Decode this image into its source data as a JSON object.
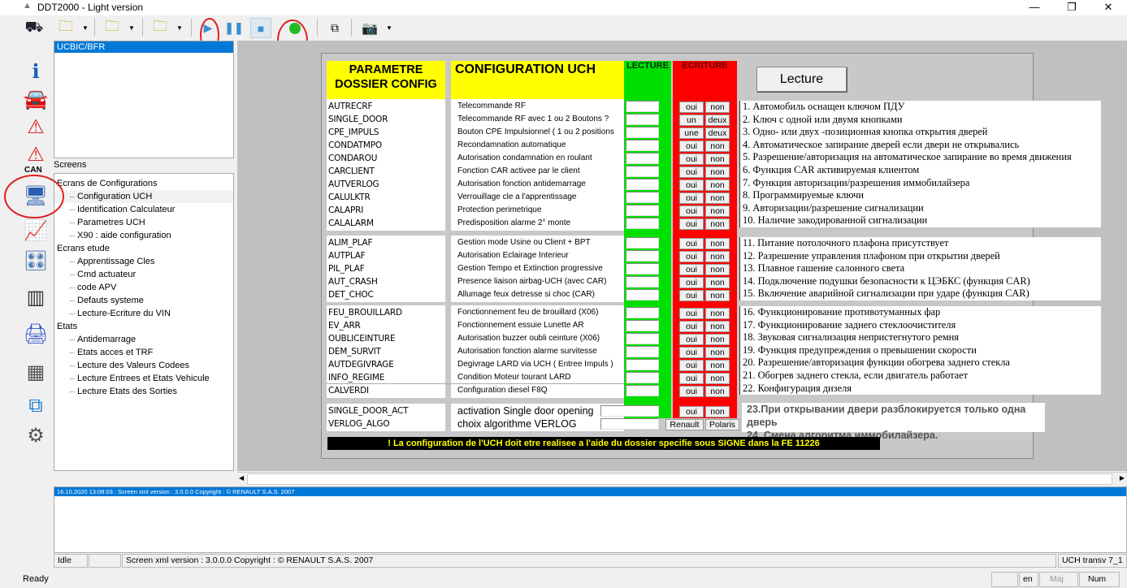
{
  "window": {
    "title": "DDT2000 - Light version",
    "controls": [
      "minimize",
      "restore",
      "close"
    ]
  },
  "toolbar": {
    "icons": [
      "binoculars-can-icon",
      "vehicle-folder-icon",
      "user-folder-icon",
      "window-folder-icon",
      "play-icon",
      "pause-icon",
      "stop-icon",
      "record-green-icon",
      "popout-window-icon",
      "camera-icon"
    ]
  },
  "left_icons": [
    "info-icon",
    "vehicle-icon",
    "warning-icon",
    "can-warning-icon",
    "monitor-icon",
    "chart-save-icon",
    "control-panel-icon",
    "barcode-icon",
    "ecu-program-icon",
    "chip-icon",
    "external-window-icon",
    "gear-icon"
  ],
  "can_label": "CAN",
  "ecu_list": {
    "selected": "UCBIC/BFR"
  },
  "screens_label": "Screens",
  "tree": [
    {
      "level": 1,
      "label": "Ecrans de Configurations"
    },
    {
      "level": 2,
      "label": "Configuration UCH"
    },
    {
      "level": 2,
      "label": "Identification Calculateur"
    },
    {
      "level": 2,
      "label": "Parametres UCH"
    },
    {
      "level": 2,
      "label": "X90 : aide configuration"
    },
    {
      "level": 1,
      "label": "Ecrans etude"
    },
    {
      "level": 2,
      "label": "Apprentissage Cles"
    },
    {
      "level": 2,
      "label": "Cmd actuateur"
    },
    {
      "level": 2,
      "label": "code APV"
    },
    {
      "level": 2,
      "label": "Defauts systeme"
    },
    {
      "level": 2,
      "label": "Lecture-Ecriture du VIN"
    },
    {
      "level": 1,
      "label": "Etats"
    },
    {
      "level": 2,
      "label": "Antidemarrage"
    },
    {
      "level": 2,
      "label": "Etats acces et TRF"
    },
    {
      "level": 2,
      "label": "Lecture des Valeurs Codees"
    },
    {
      "level": 2,
      "label": "Lecture Entrees et Etats Vehicule"
    },
    {
      "level": 2,
      "label": "Lecture Etats des Sorties"
    }
  ],
  "config": {
    "header_param": "PARAMETRE DOSSIER CONFIG",
    "header_config": "CONFIGURATION UCH",
    "header_lecture": "LECTURE",
    "header_ecriture": "ECRITURE",
    "lecture_button": "Lecture",
    "colors": {
      "yellow": "#ffff00",
      "green": "#00e000",
      "red": "#ff0000"
    },
    "groups": [
      [
        {
          "param": "AUTRECRF",
          "desc": "Telecommande RF",
          "value": "",
          "b1": "oui",
          "b2": "non"
        },
        {
          "param": "SINGLE_DOOR",
          "desc": "Telecommande RF avec 1 ou 2 Boutons ?",
          "value": "",
          "b1": "un",
          "b2": "deux"
        },
        {
          "param": "CPE_IMPULS",
          "desc": "Bouton CPE Impulsionnel ( 1 ou 2 positions",
          "value": "",
          "b1": "une",
          "b2": "deux"
        },
        {
          "param": "CONDATMPO",
          "desc": "Recondamnation automatique",
          "value": "",
          "b1": "oui",
          "b2": "non"
        },
        {
          "param": "CONDAROU",
          "desc": "Autorisation condamnation en roulant",
          "value": "",
          "b1": "oui",
          "b2": "non"
        },
        {
          "param": "CARCLIENT",
          "desc": "Fonction CAR activee par le client",
          "value": "",
          "b1": "oui",
          "b2": "non"
        },
        {
          "param": "AUTVERLOG",
          "desc": "Autorisation  fonction antidemarrage",
          "value": "",
          "b1": "oui",
          "b2": "non"
        },
        {
          "param": "CALULKTR",
          "desc": "Verrouillage cle a l'apprentissage",
          "value": "",
          "b1": "oui",
          "b2": "non"
        },
        {
          "param": "CALAPRI",
          "desc": "Protection perimetrique",
          "value": "",
          "b1": "oui",
          "b2": "non"
        },
        {
          "param": "CALALARM",
          "desc": "Predisposition alarme 2° monte",
          "value": "",
          "b1": "oui",
          "b2": "non"
        }
      ],
      [
        {
          "param": "ALIM_PLAF",
          "desc": "Gestion mode Usine ou Client + BPT",
          "value": "",
          "b1": "oui",
          "b2": "non"
        },
        {
          "param": "AUTPLAF",
          "desc": "Autorisation Eclairage Interieur",
          "value": "",
          "b1": "oui",
          "b2": "non"
        },
        {
          "param": "PIL_PLAF",
          "desc": "Gestion Tempo et Extinction progressive",
          "value": "",
          "b1": "oui",
          "b2": "non"
        },
        {
          "param": "AUT_CRASH",
          "desc": "Presence liaison airbag-UCH (avec CAR)",
          "value": "",
          "b1": "oui",
          "b2": "non"
        },
        {
          "param": "DET_CHOC",
          "desc": "Allumage feux detresse si choc (CAR)",
          "value": "",
          "b1": "oui",
          "b2": "non"
        }
      ],
      [
        {
          "param": "FEU_BROUILLARD",
          "desc": "Fonctionnement feu de brouillard (X06)",
          "value": "",
          "b1": "oui",
          "b2": "non"
        },
        {
          "param": "EV_ARR",
          "desc": "Fonctionnement essuie Lunette AR",
          "value": "",
          "b1": "oui",
          "b2": "non"
        },
        {
          "param": "OUBLICEINTURE",
          "desc": "Autorisation buzzer oubli ceinture (X06)",
          "value": "",
          "b1": "oui",
          "b2": "non"
        },
        {
          "param": "DEM_SURVIT",
          "desc": "Autorisation fonction alarme survitesse",
          "value": "",
          "b1": "oui",
          "b2": "non"
        },
        {
          "param": "AUTDEGIVRAGE",
          "desc": "Degivrage LARD via UCH ( Entree Impuls )",
          "value": "",
          "b1": "oui",
          "b2": "non"
        },
        {
          "param": "INFO_REGIME",
          "desc": "Condition Moteur tourant LARD",
          "value": "",
          "b1": "oui",
          "b2": "non"
        },
        {
          "param": "CALVERDI",
          "desc": "Configuration diesel F8Q",
          "value": "",
          "b1": "oui",
          "b2": "non"
        }
      ],
      [
        {
          "param": "SINGLE_DOOR_ACT",
          "desc": "activation Single door opening",
          "value": "",
          "b1": "oui",
          "b2": "non"
        },
        {
          "param": "VERLOG_ALGO",
          "desc": "choix algorithme VERLOG",
          "value": "",
          "b1": "Renault",
          "b2": "Polaris"
        }
      ]
    ],
    "banner": "! La configuration de l'UCH doit etre realisee a l'aide du dossier specifie sous SIGNE dans la FE 11226"
  },
  "notes": [
    [
      "1.  Автомобиль оснащен ключом ПДУ",
      "2.  Ключ с одной или двумя кнопками",
      "3.  Одно- или двух -позиционная кнопка открытия дверей",
      "4.  Автоматическое запирание дверей если двери не открывались",
      "5.  Разрешение/авторизация на автоматическое запирание во время движения",
      "6.  Функция CAR активируемая клиентом",
      "7.  Функция авторизации/разрешения иммобилайзера",
      "8.  Программируемые ключи",
      "9.  Авторизации/разрешение сигнализации",
      "10. Наличие закодированной сигнализации"
    ],
    [
      "11. Питание  потолочного плафона присутствует",
      "12. Разрешение управления плафоном при открытии дверей",
      "13. Плавное гашение салонного света",
      "14. Подключение подушки безопасности к ЦЭБКС (функция CAR)",
      "15. Включение аварийной сигнализации при ударе (функция CAR)"
    ],
    [
      "16. Функционирование противотуманных фар",
      "17. Функционирование заднего стеклоочистителя",
      "18. Звуковая сигнализация непристегнутого ремня",
      "19. Функция  предупреждения о превышении скорости",
      "20. Разрешение/авторизация функции обогрева заднего стекла",
      "21. Обогрев заднего стекла, если двигатель работает",
      "22. Конфигурация дизеля"
    ],
    [
      "23.При открывании двери разблокируется только одна дверь",
      "24. Смена алгоритма иммобилайзера."
    ]
  ],
  "log": {
    "selected": "16.10.2020 13:08:03 : Screen xml version : 3.0.0.0  Copyright : © RENAULT S.A.S. 2007"
  },
  "status": {
    "state": "Idle",
    "message": "Screen xml version : 3.0.0.0  Copyright : © RENAULT S.A.S. 2007",
    "right": "UCH transv 7_1"
  },
  "bottom": {
    "ready": "Ready",
    "lang": "en",
    "caps": "Maj",
    "num": "Num"
  }
}
